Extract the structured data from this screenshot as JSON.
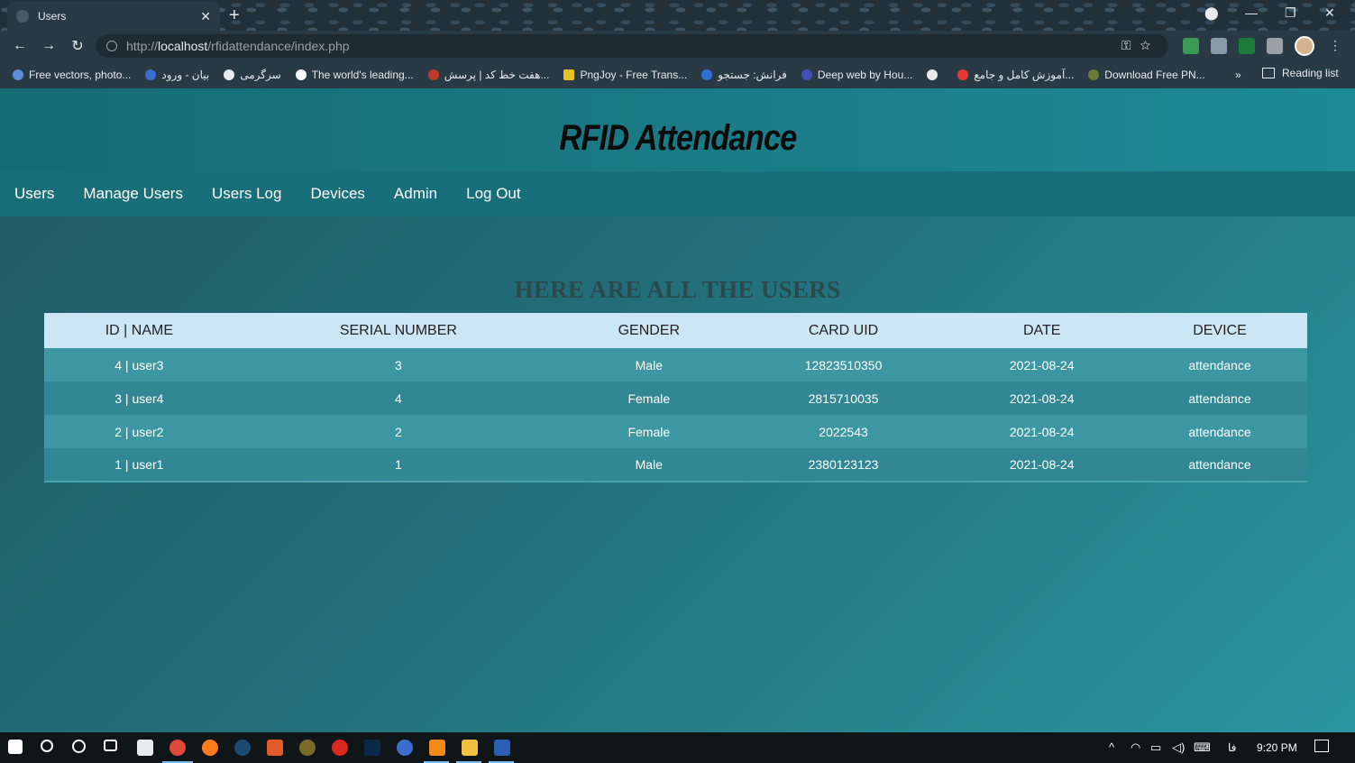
{
  "browser": {
    "tab_title": "Users",
    "tab_close": "✕",
    "new_tab": "+",
    "url_prefix": "http://",
    "url_host": "localhost",
    "url_path": "/rfidattendance/index.php",
    "bookmarks": [
      "Free vectors, photo...",
      "بیان - ورود",
      "سرگرمی",
      "The world's leading...",
      "هفت خط کد | پرسش...",
      "PngJoy - Free Trans...",
      "فرانش: جستجو",
      "Deep web by Hou...",
      "",
      "آموزش کامل و جامع...",
      "Download Free PN..."
    ],
    "bookmarks_more": "»",
    "reading_list": "Reading list",
    "accent": "#5b8fd6"
  },
  "site": {
    "logo": "RFID Attendance",
    "nav": [
      "Users",
      "Manage Users",
      "Users Log",
      "Devices",
      "Admin",
      "Log Out"
    ],
    "heading": "HERE ARE ALL THE USERS",
    "table": {
      "columns": [
        "ID | NAME",
        "SERIAL NUMBER",
        "GENDER",
        "CARD UID",
        "DATE",
        "DEVICE"
      ],
      "rows": [
        [
          "4 | user3",
          "3",
          "Male",
          "12823510350",
          "2021-08-24",
          "attendance"
        ],
        [
          "3 | user4",
          "4",
          "Female",
          "2815710035",
          "2021-08-24",
          "attendance"
        ],
        [
          "2 | user2",
          "2",
          "Female",
          "2022543",
          "2021-08-24",
          "attendance"
        ],
        [
          "1 | user1",
          "1",
          "Male",
          "2380123123",
          "2021-08-24",
          "attendance"
        ]
      ]
    },
    "colors": {
      "header_bg": "#cde6f6",
      "row_odd": "#3d97a3",
      "row_even": "#318894",
      "navbar": "#186e79"
    }
  },
  "taskbar": {
    "time": "9:20 PM",
    "language": "فا"
  }
}
